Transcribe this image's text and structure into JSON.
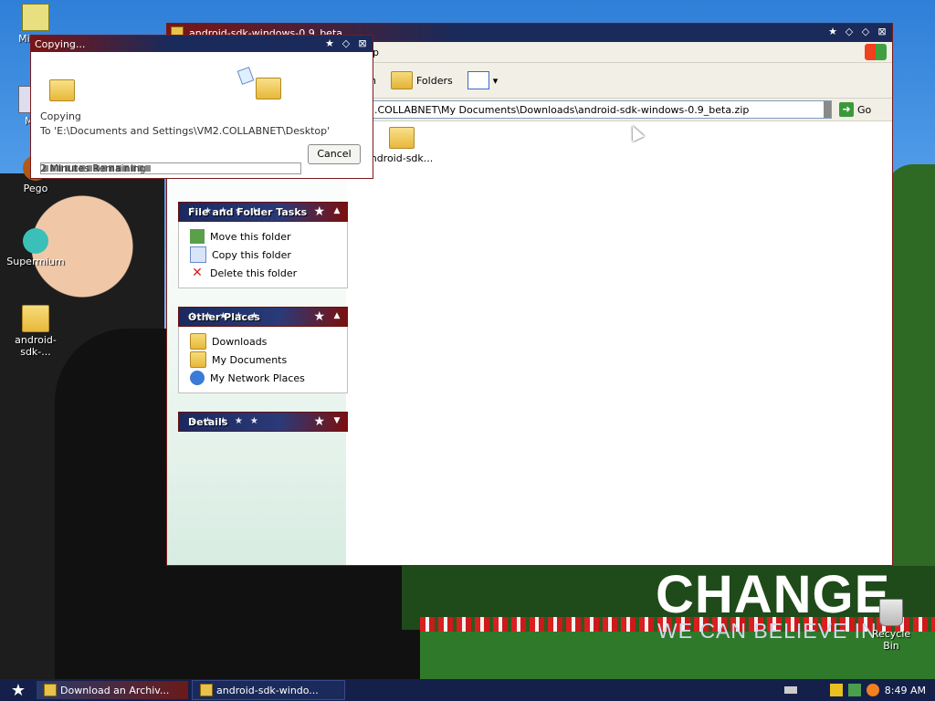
{
  "wallpaper": {
    "headline": "CHANGE",
    "subline": "WE CAN BELIEVE IN"
  },
  "desktop_icons": [
    {
      "label": "Mic Ou"
    },
    {
      "label": "My"
    },
    {
      "label": "Pego"
    },
    {
      "label": "Supermium"
    },
    {
      "label": "android-sdk-..."
    },
    {
      "label": "Recycle Bin"
    }
  ],
  "explorer": {
    "title": "android-sdk-windows-0.9_beta",
    "menu_fragment": "lp",
    "toolbar": {
      "search_fragment": "h",
      "folders_label": "Folders"
    },
    "address": ".COLLABNET\\My Documents\\Downloads\\android-sdk-windows-0.9_beta.zip",
    "go_label": "Go",
    "file_tasks": {
      "title": "File and Folder Tasks",
      "items": [
        "Move this folder",
        "Copy this folder",
        "Delete this folder"
      ]
    },
    "other_places": {
      "title": "Other Places",
      "items": [
        "Downloads",
        "My Documents",
        "My Network Places"
      ]
    },
    "details": {
      "title": "Details"
    },
    "file_item": "ndroid-sdk..."
  },
  "copy_dialog": {
    "title": "Copying...",
    "action": "Copying",
    "destination": "To 'E:\\Documents and Settings\\VM2.COLLABNET\\Desktop'",
    "remaining": "2 Minutes Remaining",
    "cancel_label": "Cancel",
    "progress": 0.43
  },
  "taskbar": {
    "buttons": [
      "Download an Archiv...",
      "android-sdk-windo..."
    ],
    "clock": "8:49 AM"
  }
}
